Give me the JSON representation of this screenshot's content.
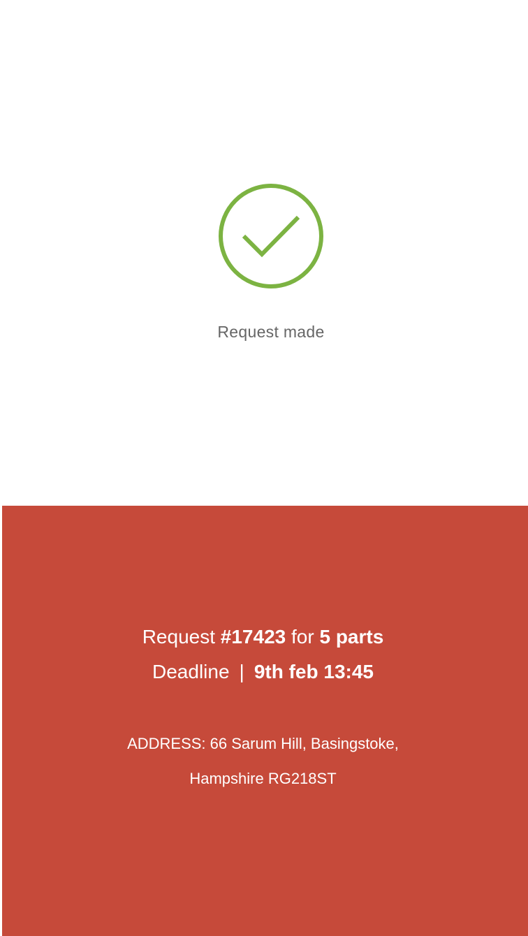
{
  "status": {
    "message": "Request made",
    "icon": "check-circle-icon",
    "icon_color": "#7cb342"
  },
  "request": {
    "label": "Request",
    "number": "#17423",
    "for_label": "for",
    "parts": "5 parts",
    "deadline_label": "Deadline",
    "separator": "|",
    "deadline_value": "9th feb 13:45",
    "address_line1": "ADDRESS: 66 Sarum Hill, Basingstoke,",
    "address_line2": "Hampshire RG218ST"
  },
  "colors": {
    "panel_background": "#c64a3a",
    "text_on_panel": "#ffffff",
    "status_text": "#666666"
  }
}
